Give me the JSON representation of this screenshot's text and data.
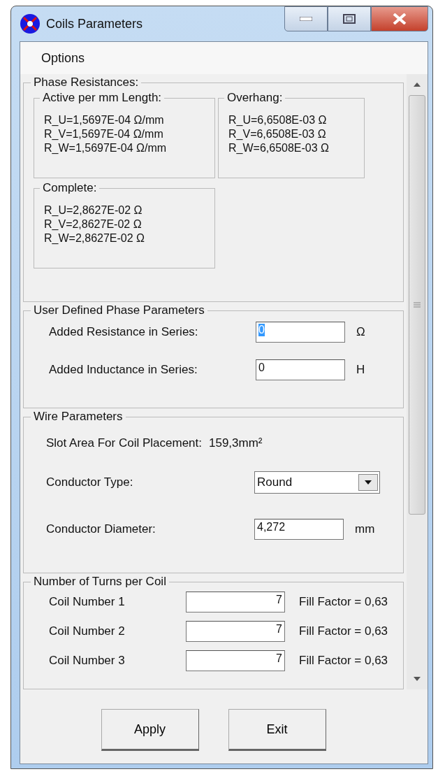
{
  "window": {
    "title": "Coils Parameters"
  },
  "menu": [
    {
      "label": "Options"
    }
  ],
  "phase_resistances": {
    "title": "Phase Resistances:",
    "groups": [
      {
        "title": "Active per mm Length:",
        "lines": [
          "R_U=1,5697E-04  Ω/mm",
          "R_V=1,5697E-04  Ω/mm",
          "R_W=1,5697E-04  Ω/mm"
        ]
      },
      {
        "title": "Overhang:",
        "lines": [
          "R_U=6,6508E-03  Ω",
          "R_V=6,6508E-03  Ω",
          "R_W=6,6508E-03  Ω"
        ]
      },
      {
        "title": "Complete:",
        "lines": [
          "R_U=2,8627E-02  Ω",
          "R_V=2,8627E-02  Ω",
          "R_W=2,8627E-02  Ω"
        ]
      }
    ]
  },
  "user_defined": {
    "title": "User Defined Phase Parameters",
    "fields": [
      {
        "label": "Added Resistance in Series:",
        "value": "0",
        "unit": "Ω",
        "selected": true
      },
      {
        "label": "Added Inductance in Series:",
        "value": "0",
        "unit": "H",
        "selected": false
      }
    ]
  },
  "wire": {
    "title": "Wire Parameters",
    "slot_area_label": "Slot Area For Coil Placement:",
    "slot_area_value": "159,3mm²",
    "conductor_type": {
      "label": "Conductor Type:",
      "value": "Round"
    },
    "conductor_diameter": {
      "label": "Conductor Diameter:",
      "value": "4,272",
      "unit": "mm"
    }
  },
  "turns": {
    "title": "Number of Turns per Coil",
    "coils": [
      {
        "label": "Coil Number 1",
        "value": "7",
        "fill": "Fill Factor = 0,63"
      },
      {
        "label": "Coil Number 2",
        "value": "7",
        "fill": "Fill Factor = 0,63"
      },
      {
        "label": "Coil Number 3",
        "value": "7",
        "fill": "Fill Factor = 0,63"
      }
    ]
  },
  "buttons": [
    "Apply",
    "Exit"
  ]
}
